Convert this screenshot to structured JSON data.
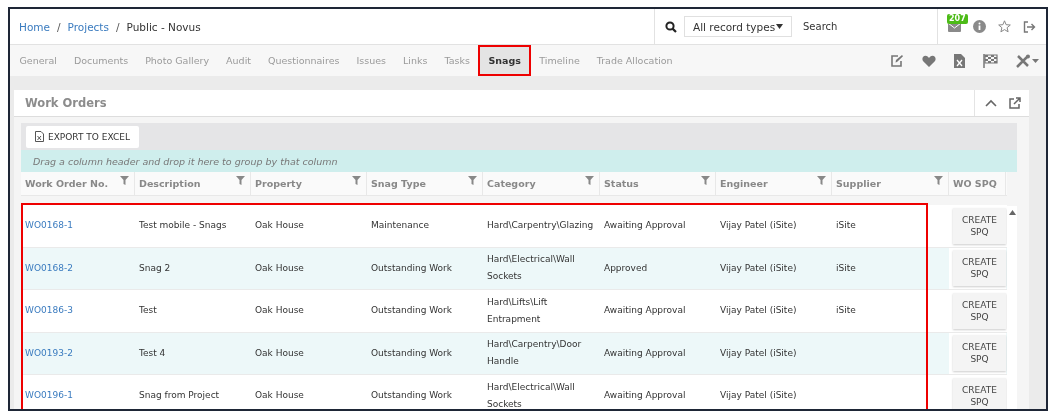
{
  "breadcrumb": [
    {
      "label": "Home",
      "link": true
    },
    {
      "separator": "/",
      "label": "Projects",
      "link": true
    },
    {
      "separator": "/",
      "label": "Public - Novus",
      "link": false
    }
  ],
  "search": {
    "scope": "All record types",
    "placeholder": "Search"
  },
  "notifications": {
    "count": "207"
  },
  "tabs": [
    {
      "label": "General",
      "selected": false,
      "boxed": false
    },
    {
      "label": "Documents",
      "selected": false,
      "boxed": false
    },
    {
      "label": "Photo Gallery",
      "selected": false,
      "boxed": false
    },
    {
      "label": "Audit",
      "selected": false,
      "boxed": false
    },
    {
      "label": "Questionnaires",
      "selected": false,
      "boxed": false
    },
    {
      "label": "Issues",
      "selected": false,
      "boxed": false
    },
    {
      "label": "Links",
      "selected": false,
      "boxed": false
    },
    {
      "label": "Tasks",
      "selected": false,
      "boxed": false
    },
    {
      "label": "Snags",
      "selected": true,
      "boxed": true
    },
    {
      "label": "Timeline",
      "selected": false,
      "boxed": false
    },
    {
      "label": "Trade Allocation",
      "selected": false,
      "boxed": false
    }
  ],
  "panel": {
    "title": "Work Orders",
    "export_button": "EXPORT TO EXCEL",
    "group_hint": "Drag a column header and drop it here to group by that column",
    "columns": [
      {
        "label": "Work Order No.",
        "filter": true
      },
      {
        "label": "Description",
        "filter": true
      },
      {
        "label": "Property",
        "filter": true
      },
      {
        "label": "Snag Type",
        "filter": true
      },
      {
        "label": "Category",
        "filter": true
      },
      {
        "label": "Status",
        "filter": true
      },
      {
        "label": "Engineer",
        "filter": true
      },
      {
        "label": "Supplier",
        "filter": true
      },
      {
        "label": "WO SPQ",
        "filter": false
      }
    ],
    "rows_boxed": true,
    "rows": [
      {
        "work_order": "WO0168-1",
        "description": "Test mobile - Snags",
        "property": "Oak House",
        "snag_type": "Maintenance",
        "category": "Hard\\Carpentry\\Glazing",
        "status": "Awaiting Approval",
        "engineer": "Vijay Patel (iSite)",
        "supplier": "iSite",
        "action": "CREATE SPQ"
      },
      {
        "work_order": "WO0168-2",
        "description": "Snag 2",
        "property": "Oak House",
        "snag_type": "Outstanding Work",
        "category": "Hard\\Electrical\\Wall Sockets",
        "status": "Approved",
        "engineer": "Vijay Patel (iSite)",
        "supplier": "iSite",
        "action": "CREATE SPQ"
      },
      {
        "work_order": "WO0186-3",
        "description": "Test",
        "property": "Oak House",
        "snag_type": "Outstanding Work",
        "category": "Hard\\Lifts\\Lift Entrapment",
        "status": "Awaiting Approval",
        "engineer": "Vijay Patel (iSite)",
        "supplier": "iSite",
        "action": "CREATE SPQ"
      },
      {
        "work_order": "WO0193-2",
        "description": "Test 4",
        "property": "Oak House",
        "snag_type": "Outstanding Work",
        "category": "Hard\\Carpentry\\Door Handle",
        "status": "Awaiting Approval",
        "engineer": "Vijay Patel (iSite)",
        "action": "CREATE SPQ"
      },
      {
        "work_order": "WO0196-1",
        "description": "Snag from Project",
        "property": "Oak House",
        "snag_type": "Outstanding Work",
        "category": "Hard\\Electrical\\Wall Sockets",
        "status": "Awaiting Approval",
        "engineer": "Vijay Patel (iSite)",
        "action": "CREATE SPQ"
      }
    ]
  }
}
